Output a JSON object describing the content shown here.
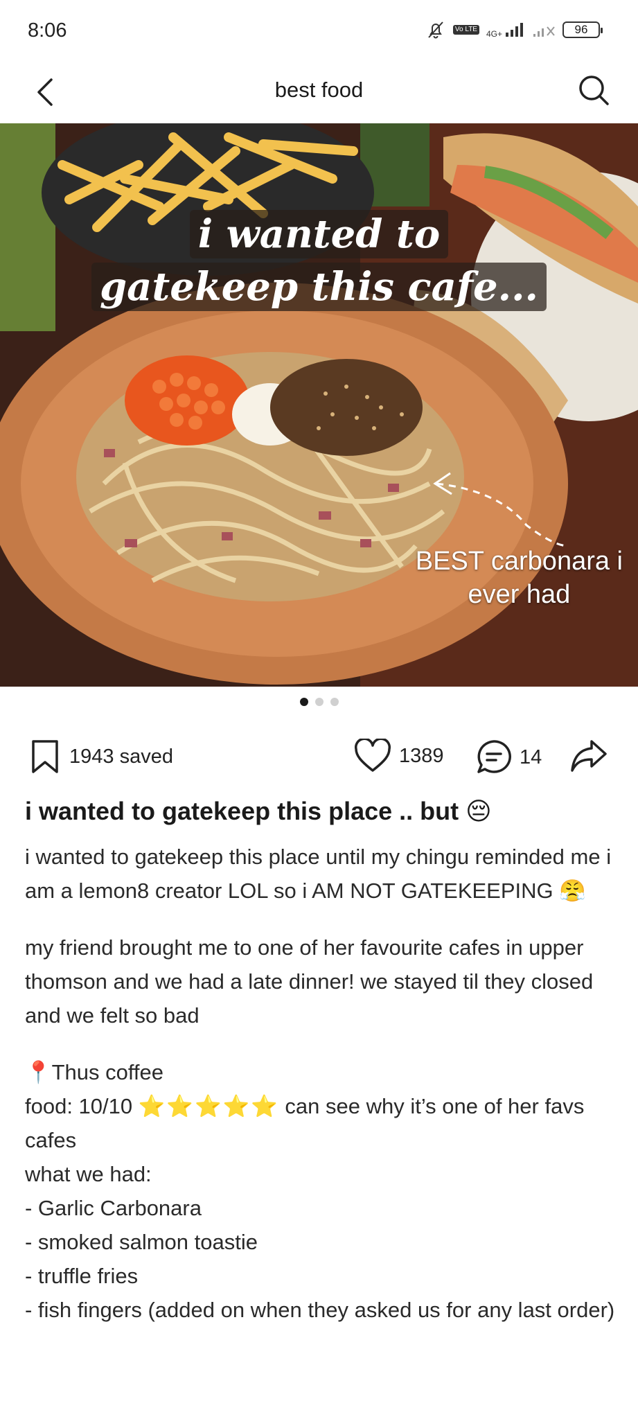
{
  "status_bar": {
    "time": "8:06",
    "network": "4G+",
    "volte": "Vo LTE",
    "battery": "96"
  },
  "header": {
    "title": "best food"
  },
  "photo": {
    "overlay_line1": "i wanted to",
    "overlay_line2": "gatekeep this cafe...",
    "caption_line1": "BEST carbonara i",
    "caption_line2": "ever had"
  },
  "actions": {
    "saved": "1943 saved",
    "likes": "1389",
    "comments": "14"
  },
  "post": {
    "title": "i wanted to gatekeep this place .. but 😔",
    "p1": "i wanted to gatekeep this place until my chingu reminded me i am a lemon8 creator LOL so i AM NOT GATEKEEPING 😤",
    "p2": "my friend brought me to one of her favourite cafes in upper thomson and we had a late dinner! we stayed til they closed and we felt so bad",
    "place": "Thus coffee",
    "food_prefix": "food: 10/10",
    "food_stars": "⭐⭐⭐⭐⭐",
    "food_suffix": "can see why it’s one of her favs cafes",
    "what_we_had": "what we had:",
    "items": [
      "- Garlic Carbonara",
      "- smoked salmon toastie",
      "- truffle fries",
      "- fish fingers (added on when they asked us for any last order)"
    ]
  },
  "colors": {
    "accent": "#1a1a1a",
    "star": "#f5c518",
    "pin": "#e53935"
  }
}
